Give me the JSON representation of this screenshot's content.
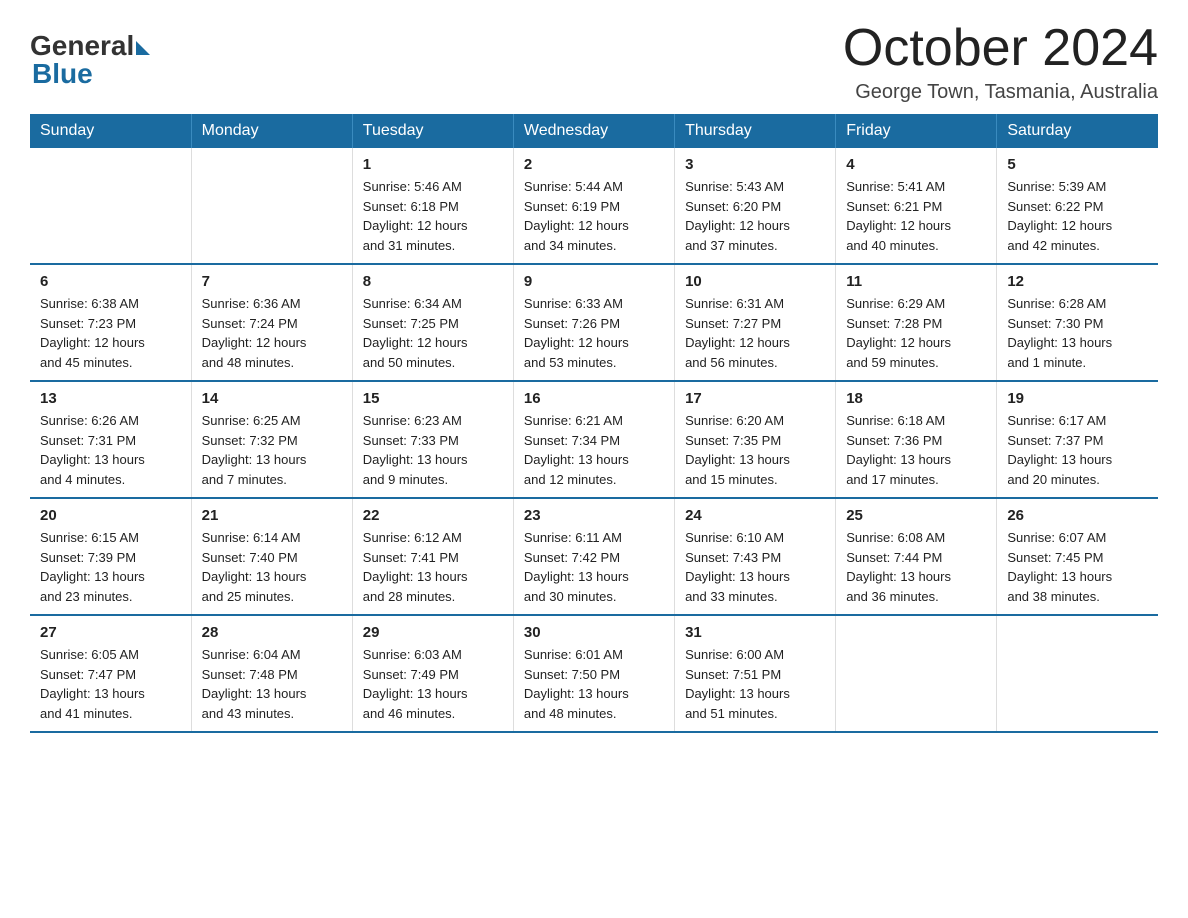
{
  "logo": {
    "general": "General",
    "blue": "Blue"
  },
  "title": "October 2024",
  "subtitle": "George Town, Tasmania, Australia",
  "days_of_week": [
    "Sunday",
    "Monday",
    "Tuesday",
    "Wednesday",
    "Thursday",
    "Friday",
    "Saturday"
  ],
  "weeks": [
    [
      {
        "day": "",
        "info": ""
      },
      {
        "day": "",
        "info": ""
      },
      {
        "day": "1",
        "info": "Sunrise: 5:46 AM\nSunset: 6:18 PM\nDaylight: 12 hours\nand 31 minutes."
      },
      {
        "day": "2",
        "info": "Sunrise: 5:44 AM\nSunset: 6:19 PM\nDaylight: 12 hours\nand 34 minutes."
      },
      {
        "day": "3",
        "info": "Sunrise: 5:43 AM\nSunset: 6:20 PM\nDaylight: 12 hours\nand 37 minutes."
      },
      {
        "day": "4",
        "info": "Sunrise: 5:41 AM\nSunset: 6:21 PM\nDaylight: 12 hours\nand 40 minutes."
      },
      {
        "day": "5",
        "info": "Sunrise: 5:39 AM\nSunset: 6:22 PM\nDaylight: 12 hours\nand 42 minutes."
      }
    ],
    [
      {
        "day": "6",
        "info": "Sunrise: 6:38 AM\nSunset: 7:23 PM\nDaylight: 12 hours\nand 45 minutes."
      },
      {
        "day": "7",
        "info": "Sunrise: 6:36 AM\nSunset: 7:24 PM\nDaylight: 12 hours\nand 48 minutes."
      },
      {
        "day": "8",
        "info": "Sunrise: 6:34 AM\nSunset: 7:25 PM\nDaylight: 12 hours\nand 50 minutes."
      },
      {
        "day": "9",
        "info": "Sunrise: 6:33 AM\nSunset: 7:26 PM\nDaylight: 12 hours\nand 53 minutes."
      },
      {
        "day": "10",
        "info": "Sunrise: 6:31 AM\nSunset: 7:27 PM\nDaylight: 12 hours\nand 56 minutes."
      },
      {
        "day": "11",
        "info": "Sunrise: 6:29 AM\nSunset: 7:28 PM\nDaylight: 12 hours\nand 59 minutes."
      },
      {
        "day": "12",
        "info": "Sunrise: 6:28 AM\nSunset: 7:30 PM\nDaylight: 13 hours\nand 1 minute."
      }
    ],
    [
      {
        "day": "13",
        "info": "Sunrise: 6:26 AM\nSunset: 7:31 PM\nDaylight: 13 hours\nand 4 minutes."
      },
      {
        "day": "14",
        "info": "Sunrise: 6:25 AM\nSunset: 7:32 PM\nDaylight: 13 hours\nand 7 minutes."
      },
      {
        "day": "15",
        "info": "Sunrise: 6:23 AM\nSunset: 7:33 PM\nDaylight: 13 hours\nand 9 minutes."
      },
      {
        "day": "16",
        "info": "Sunrise: 6:21 AM\nSunset: 7:34 PM\nDaylight: 13 hours\nand 12 minutes."
      },
      {
        "day": "17",
        "info": "Sunrise: 6:20 AM\nSunset: 7:35 PM\nDaylight: 13 hours\nand 15 minutes."
      },
      {
        "day": "18",
        "info": "Sunrise: 6:18 AM\nSunset: 7:36 PM\nDaylight: 13 hours\nand 17 minutes."
      },
      {
        "day": "19",
        "info": "Sunrise: 6:17 AM\nSunset: 7:37 PM\nDaylight: 13 hours\nand 20 minutes."
      }
    ],
    [
      {
        "day": "20",
        "info": "Sunrise: 6:15 AM\nSunset: 7:39 PM\nDaylight: 13 hours\nand 23 minutes."
      },
      {
        "day": "21",
        "info": "Sunrise: 6:14 AM\nSunset: 7:40 PM\nDaylight: 13 hours\nand 25 minutes."
      },
      {
        "day": "22",
        "info": "Sunrise: 6:12 AM\nSunset: 7:41 PM\nDaylight: 13 hours\nand 28 minutes."
      },
      {
        "day": "23",
        "info": "Sunrise: 6:11 AM\nSunset: 7:42 PM\nDaylight: 13 hours\nand 30 minutes."
      },
      {
        "day": "24",
        "info": "Sunrise: 6:10 AM\nSunset: 7:43 PM\nDaylight: 13 hours\nand 33 minutes."
      },
      {
        "day": "25",
        "info": "Sunrise: 6:08 AM\nSunset: 7:44 PM\nDaylight: 13 hours\nand 36 minutes."
      },
      {
        "day": "26",
        "info": "Sunrise: 6:07 AM\nSunset: 7:45 PM\nDaylight: 13 hours\nand 38 minutes."
      }
    ],
    [
      {
        "day": "27",
        "info": "Sunrise: 6:05 AM\nSunset: 7:47 PM\nDaylight: 13 hours\nand 41 minutes."
      },
      {
        "day": "28",
        "info": "Sunrise: 6:04 AM\nSunset: 7:48 PM\nDaylight: 13 hours\nand 43 minutes."
      },
      {
        "day": "29",
        "info": "Sunrise: 6:03 AM\nSunset: 7:49 PM\nDaylight: 13 hours\nand 46 minutes."
      },
      {
        "day": "30",
        "info": "Sunrise: 6:01 AM\nSunset: 7:50 PM\nDaylight: 13 hours\nand 48 minutes."
      },
      {
        "day": "31",
        "info": "Sunrise: 6:00 AM\nSunset: 7:51 PM\nDaylight: 13 hours\nand 51 minutes."
      },
      {
        "day": "",
        "info": ""
      },
      {
        "day": "",
        "info": ""
      }
    ]
  ]
}
